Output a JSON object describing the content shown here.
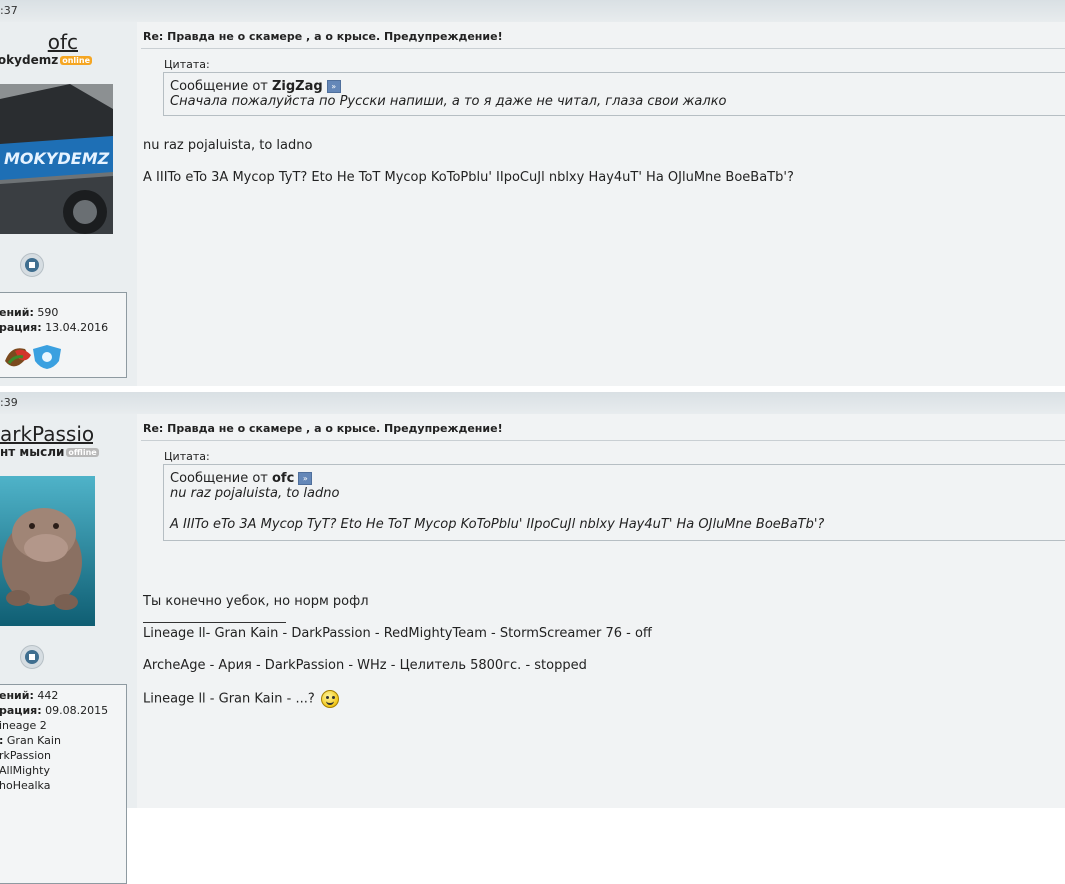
{
  "posts": [
    {
      "time": ":37",
      "username": "ofc",
      "usertitle": "mokydemz",
      "status": "online",
      "avatar_text": "MOKYDEMZ",
      "stats": [
        {
          "label": "ений:",
          "value": " 590"
        },
        {
          "label": "рация:",
          "value": " 13.04.2016"
        }
      ],
      "title": "Re: Правда не о скамере , а о крысе. Предупреждение!",
      "quote_caption": "Цитата:",
      "quote_prefix": "Сообщение от ",
      "quote_author": "ZigZag",
      "quote_lines": [
        "Сначала пожалуйста по Русски напиши, а то я даже не читал, глаза свои жалко"
      ],
      "lines": [
        "nu raz pojaluista, to ladno",
        "А IIITo eTo 3A Mycop TyT? Eto He ToT Mycop KoToPblu' IIpoCuJl nblxy Hay4uT' Ha OJluMne BoeBaTb'?"
      ]
    },
    {
      "time": ":39",
      "username": "arkPassion",
      "usertitle": "нт мысли",
      "status": "offline",
      "stats": [
        {
          "label": "ений:",
          "value": " 442"
        },
        {
          "label": "рация:",
          "value": " 09.08.2015"
        },
        {
          "label": "",
          "value": "ineage 2"
        },
        {
          "label": ":",
          "value": " Gran Kain"
        },
        {
          "label": "",
          "value": "rkPassion"
        },
        {
          "label": "",
          "value": "AllMighty"
        },
        {
          "label": "",
          "value": "hoHealka"
        }
      ],
      "title": "Re: Правда не о скамере , а о крысе. Предупреждение!",
      "quote_caption": "Цитата:",
      "quote_prefix": "Сообщение от ",
      "quote_author": "ofc",
      "quote_lines": [
        "nu raz pojaluista, to ladno",
        "А IIITo eTo 3A Mycop TyT? Eto He ToT Mycop KoToPblu' IIpoCuJl nblxy Hay4uT' Ha OJluMne BoeBaTb'?"
      ],
      "lines": [
        "Ты конечно уебок, но норм рофл"
      ],
      "signature": [
        "Lineage ll- Gran Kain - DarkPassion - RedMightyTeam - StormScreamer 76 - off",
        "ArcheAge - Ария - DarkPassion - WHz - Целитель 5800гс. - stopped",
        "Lineage ll - Gran Kain - ...?"
      ]
    }
  ],
  "badges": {
    "online": "online",
    "offline": "offline"
  }
}
